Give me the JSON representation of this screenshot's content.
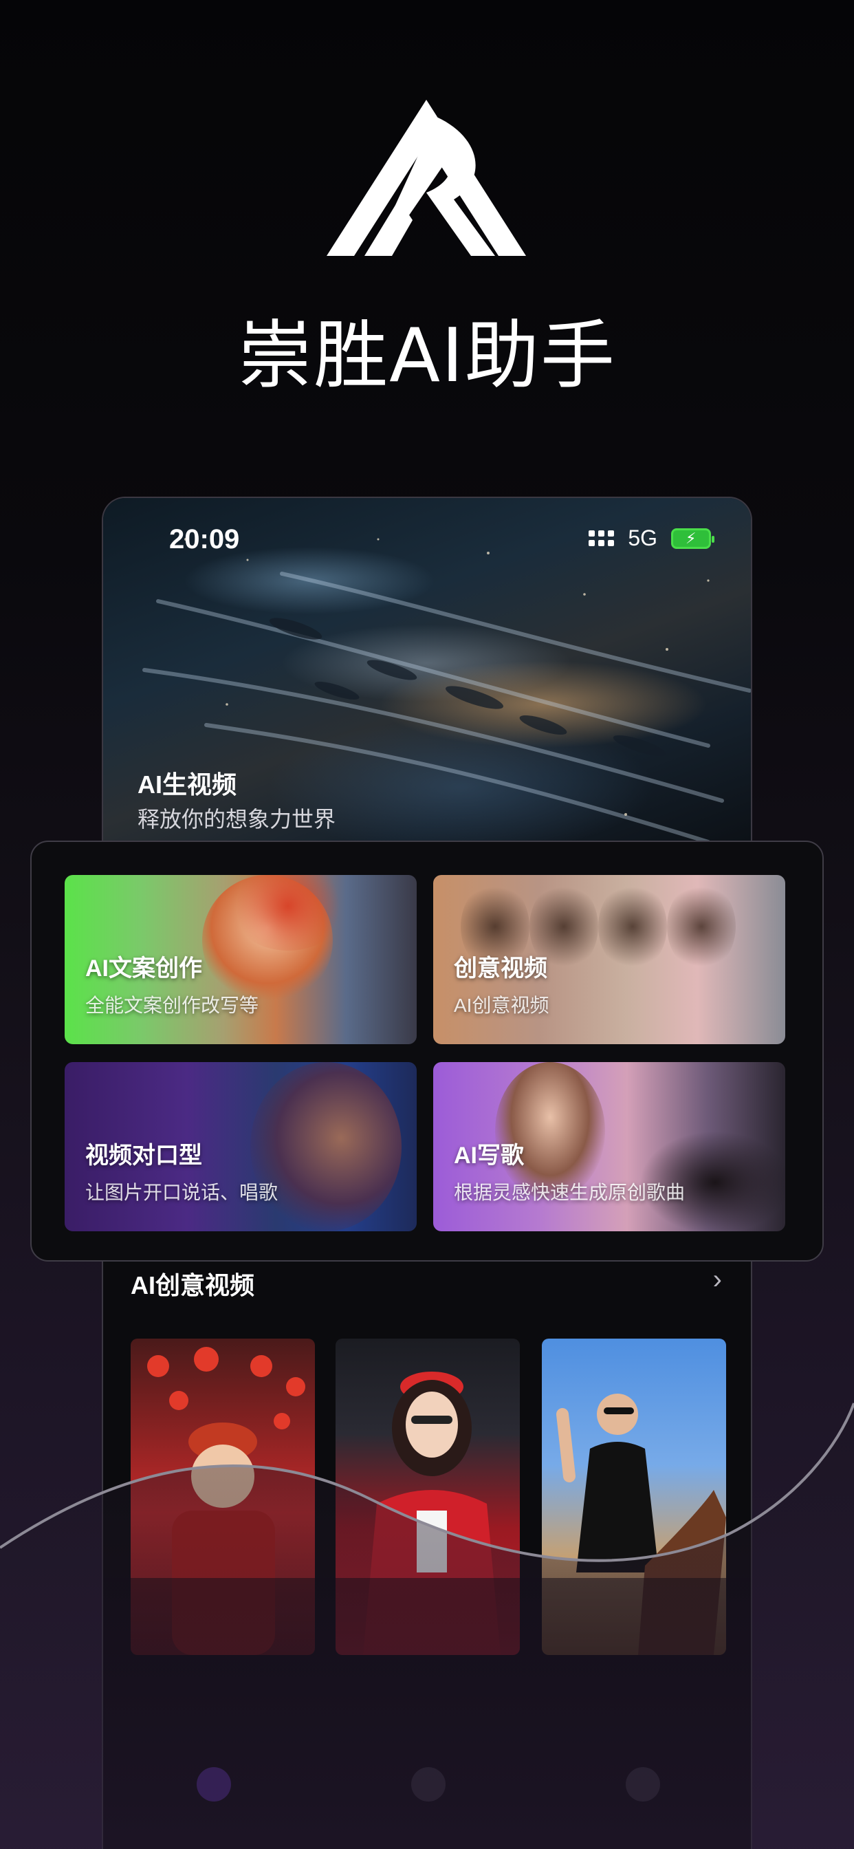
{
  "app": {
    "title": "崇胜AI助手"
  },
  "status_bar": {
    "time": "20:09",
    "network": "5G"
  },
  "hero": {
    "title": "AI生视频",
    "subtitle": "释放你的想象力世界"
  },
  "features": [
    {
      "title": "AI文案创作",
      "subtitle": "全能文案创作改写等"
    },
    {
      "title": "创意视频",
      "subtitle": "AI创意视频"
    },
    {
      "title": "视频对口型",
      "subtitle": "让图片开口说话、唱歌"
    },
    {
      "title": "AI写歌",
      "subtitle": "根据灵感快速生成原创歌曲"
    }
  ],
  "creative_section": {
    "title": "AI创意视频"
  },
  "icons": {
    "logo": "brand-logo",
    "chevron": "chevron-right-icon",
    "signal": "signal-icon",
    "battery": "battery-charging-icon"
  },
  "colors": {
    "accent_purple": "#7a3fe0",
    "battery_green": "#4ade4a"
  }
}
